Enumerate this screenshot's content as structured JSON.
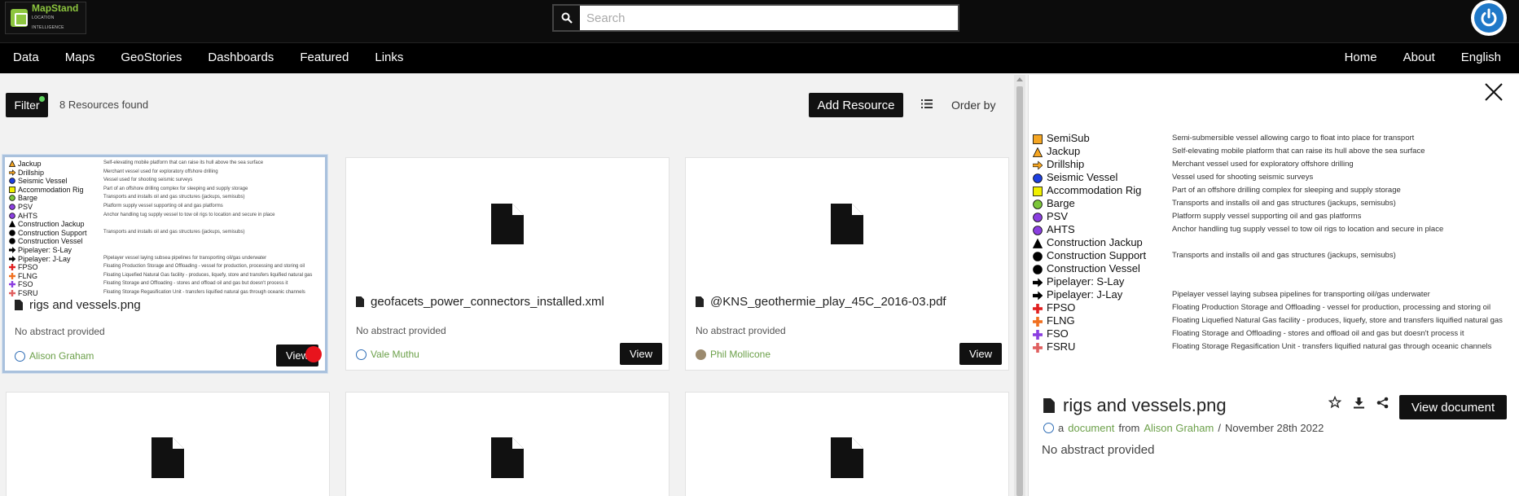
{
  "brand": {
    "name": "MapStand",
    "tagline": "LOCATION INTELLIGENCE"
  },
  "search": {
    "placeholder": "Search",
    "value": ""
  },
  "nav": {
    "left": [
      "Data",
      "Maps",
      "GeoStories",
      "Dashboards",
      "Featured",
      "Links"
    ],
    "right": [
      "Home",
      "About",
      "English"
    ]
  },
  "toolbar": {
    "filter_label": "Filter",
    "count_text": "8 Resources found",
    "add_resource_label": "Add Resource",
    "order_by_label": "Order by"
  },
  "cards": [
    {
      "title": "rigs and vessels.png",
      "abstract": "No abstract provided",
      "owner": "Alison Graham",
      "view_label": "View"
    },
    {
      "title": "geofacets_power_connectors_installed.xml",
      "abstract": "No abstract provided",
      "owner": "Vale Muthu",
      "view_label": "View"
    },
    {
      "title": "@KNS_geothermie_play_45C_2016-03.pdf",
      "abstract": "No abstract provided",
      "owner": "Phil Mollicone",
      "view_label": "View"
    }
  ],
  "legend": [
    {
      "name": "SemiSub",
      "desc": "Semi-submersible vessel allowing cargo to float into place for transport",
      "symbol": "square",
      "color": "#f5a623"
    },
    {
      "name": "Jackup",
      "desc": "Self-elevating mobile platform that can raise its hull above the sea surface",
      "symbol": "triangle",
      "color": "#f5a623"
    },
    {
      "name": "Drillship",
      "desc": "Merchant vessel used for exploratory offshore drilling",
      "symbol": "arrow",
      "color": "#f5a623"
    },
    {
      "name": "Seismic Vessel",
      "desc": "Vessel used for shooting seismic surveys",
      "symbol": "circle",
      "color": "#1e3fe0"
    },
    {
      "name": "Accommodation Rig",
      "desc": "Part of an offshore drilling complex for sleeping and supply storage",
      "symbol": "square",
      "color": "#f0f000"
    },
    {
      "name": "Barge",
      "desc": "Transports and installs oil and gas structures (jackups, semisubs)",
      "symbol": "circle",
      "color": "#7cc63a"
    },
    {
      "name": "PSV",
      "desc": "Platform supply vessel supporting oil and gas platforms",
      "symbol": "circle",
      "color": "#8b3fe0"
    },
    {
      "name": "AHTS",
      "desc": "Anchor handling tug supply vessel to tow oil rigs to location and secure in place",
      "symbol": "circle",
      "color": "#8b3fe0"
    },
    {
      "name": "Construction Jackup",
      "desc": "",
      "symbol": "triangle",
      "color": "#000000"
    },
    {
      "name": "Construction Support",
      "desc": "Transports and installs oil and gas structures (jackups, semisubs)",
      "symbol": "circle",
      "color": "#000000"
    },
    {
      "name": "Construction Vessel",
      "desc": "",
      "symbol": "circle",
      "color": "#000000"
    },
    {
      "name": "Pipelayer: S-Lay",
      "desc": "",
      "symbol": "arrow",
      "color": "#000000"
    },
    {
      "name": "Pipelayer: J-Lay",
      "desc": "Pipelayer vessel laying subsea pipelines for transporting oil/gas underwater",
      "symbol": "arrow",
      "color": "#000000"
    },
    {
      "name": "FPSO",
      "desc": "Floating Production Storage and Offloading - vessel for production, processing and storing oil",
      "symbol": "cross",
      "color": "#e02020"
    },
    {
      "name": "FLNG",
      "desc": "Floating Liquefied Natural Gas facility - produces, liquefy, store and transfers liquified natural gas",
      "symbol": "cross",
      "color": "#f07020"
    },
    {
      "name": "FSO",
      "desc": "Floating Storage and Offloading - stores and offload oil and gas but doesn't process it",
      "symbol": "cross",
      "color": "#8b3fe0"
    },
    {
      "name": "FSRU",
      "desc": "Floating Storage Regasification Unit - transfers liquified natural gas through oceanic channels",
      "symbol": "cross",
      "color": "#e06060"
    }
  ],
  "panel": {
    "title": "rigs and vessels.png",
    "view_document_label": "View document",
    "meta_prefix": "a",
    "meta_type": "document",
    "meta_from": "from",
    "meta_owner": "Alison Graham",
    "meta_sep": "/",
    "meta_date": "November 28th 2022",
    "abstract": "No abstract provided"
  },
  "colors": {
    "accent_green": "#6ca04a",
    "brand_green": "#8dc63f",
    "user_blue": "#1f78c8",
    "selection_dot": "#e8141d"
  }
}
